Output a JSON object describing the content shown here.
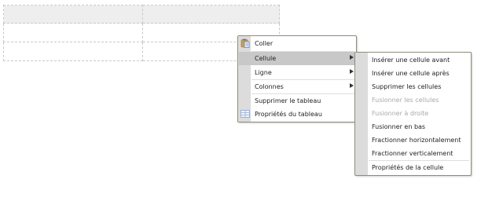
{
  "main_menu": {
    "items": [
      {
        "label": "Coller",
        "icon": "paste-icon"
      },
      {
        "label": "Cellule",
        "submenu": true,
        "highlighted": true
      },
      {
        "label": "Ligne",
        "submenu": true
      },
      {
        "label": "Colonnes",
        "submenu": true
      },
      {
        "label": "Supprimer le tableau"
      },
      {
        "label": "Propriétés du tableau",
        "icon": "table-properties-icon"
      }
    ]
  },
  "cell_submenu": {
    "items": [
      {
        "label": "Insérer une cellule avant"
      },
      {
        "label": "Insérer une cellule après"
      },
      {
        "label": "Supprimer les cellules"
      },
      {
        "label": "Fusionner les cellules",
        "disabled": true
      },
      {
        "label": "Fusionner à droite",
        "disabled": true
      },
      {
        "label": "Fusionner en bas"
      },
      {
        "label": "Fractionner horizontalement"
      },
      {
        "label": "Fractionner verticalement"
      },
      {
        "label": "Propriétés de la cellule"
      }
    ]
  },
  "colors": {
    "highlight": "#c8c8c8",
    "gutter": "#dcdcdc",
    "menu_border": "#8c8c7a",
    "disabled_text": "#a8a8a8"
  }
}
